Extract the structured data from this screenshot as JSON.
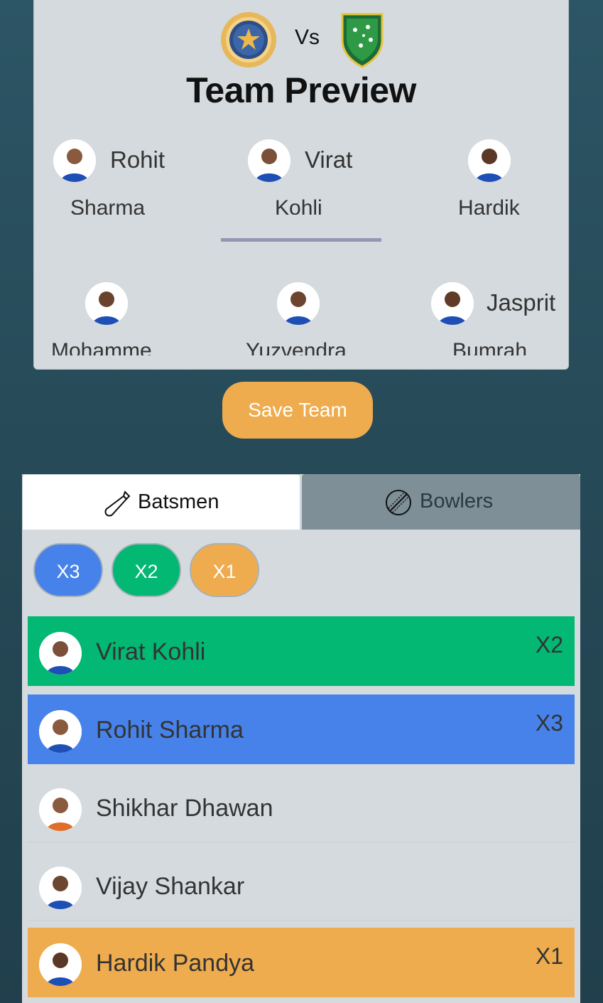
{
  "header": {
    "vs_label": "Vs",
    "title": "Team Preview"
  },
  "preview_players": [
    {
      "first": "Rohit",
      "last": "Sharma"
    },
    {
      "first": "Virat",
      "last": "Kohli"
    },
    {
      "first": "",
      "last": "Hardik"
    },
    {
      "first": "",
      "last": "Mohamme"
    },
    {
      "first": "",
      "last": "Yuzvendra"
    },
    {
      "first": "Jasprit",
      "last": "Bumrah"
    }
  ],
  "actions": {
    "save_label": "Save Team"
  },
  "tabs": [
    {
      "label": "Batsmen",
      "icon": "cricket-bat-icon",
      "active": true
    },
    {
      "label": "Bowlers",
      "icon": "cricket-ball-icon",
      "active": false
    }
  ],
  "multipliers": [
    {
      "label": "X3",
      "color": "#4682ea"
    },
    {
      "label": "X2",
      "color": "#02b873"
    },
    {
      "label": "X1",
      "color": "#eeac4e"
    }
  ],
  "batsmen": [
    {
      "name": "Virat Kohli",
      "multiplier": "X2",
      "color": "#02b873"
    },
    {
      "name": "Rohit Sharma",
      "multiplier": "X3",
      "color": "#4682ea"
    },
    {
      "name": "Shikhar Dhawan",
      "multiplier": "",
      "color": ""
    },
    {
      "name": "Vijay Shankar",
      "multiplier": "",
      "color": ""
    },
    {
      "name": "Hardik Pandya",
      "multiplier": "X1",
      "color": "#eeac4e"
    }
  ]
}
